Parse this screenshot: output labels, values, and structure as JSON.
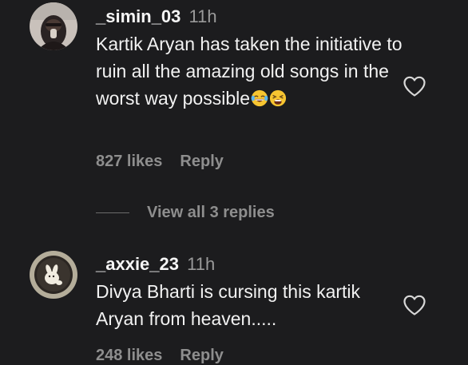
{
  "comments": [
    {
      "username": "_simin_03",
      "time": "11h",
      "text": "Kartik Aryan has taken the initiative to ruin all the amazing old songs in the worst way possible",
      "emojis": [
        "face-with-tears-of-joy",
        "tired-face"
      ],
      "likes": "827 likes",
      "reply_label": "Reply",
      "view_replies": "View all 3 replies"
    },
    {
      "username": "_axxie_23",
      "time": "11h",
      "text": "Divya Bharti is cursing this kartik Aryan from heaven.....",
      "likes": "248 likes",
      "reply_label": "Reply"
    }
  ],
  "colors": {
    "background": "#1c1c1e",
    "primary_text": "#f2f2f2",
    "secondary_text": "#8e8e8e"
  },
  "icons": {
    "like": "heart-outline-icon"
  }
}
